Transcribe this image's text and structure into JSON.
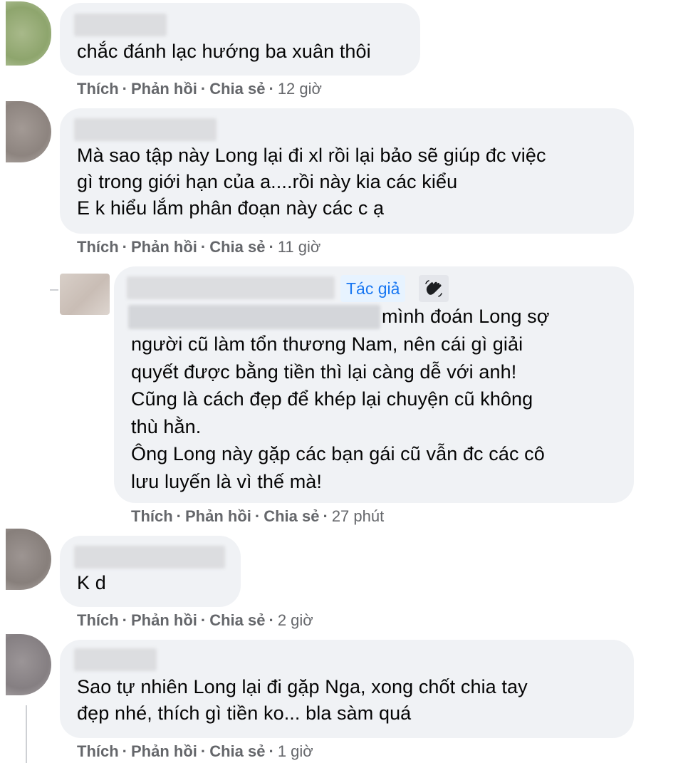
{
  "actions": {
    "like": "Thích",
    "reply": "Phản hồi",
    "share": "Chia sẻ",
    "sep": "·"
  },
  "author_badge": "Tác giả",
  "icons": {
    "wave": "waving-hand-icon"
  },
  "colors": {
    "bubble": "#f0f2f5",
    "action_text": "#65676b",
    "badge_text": "#1877f2",
    "badge_bg": "#e7f3ff"
  },
  "comments": [
    {
      "text": "chắc đánh lạc hướng ba xuân thôi",
      "time": "12 giờ"
    },
    {
      "text": "Mà sao tập này Long lại đi xl rồi lại bảo sẽ giúp đc việc\ngì trong giới hạn của a....rồi này kia các kiểu\nE k hiểu lắm phân đoạn này các c ạ",
      "time": "11 giờ"
    },
    {
      "first_line": "mình đoán Long sợ",
      "text": "người cũ làm tổn thương Nam, nên cái gì giải\nquyết được bằng tiền thì lại càng dễ với anh!\nCũng là cách đẹp để khép lại chuyện cũ không\nthù hằn.\nÔng Long này gặp các bạn gái cũ vẫn đc các cô\nlưu luyến là vì thế mà!",
      "time": "27 phút"
    },
    {
      "text": "K d",
      "time": "2 giờ"
    },
    {
      "text": "Sao tự nhiên Long lại đi gặp Nga, xong chốt chia tay\nđẹp nhé, thích gì tiền ko... bla sàm quá",
      "time": "1 giờ"
    }
  ]
}
